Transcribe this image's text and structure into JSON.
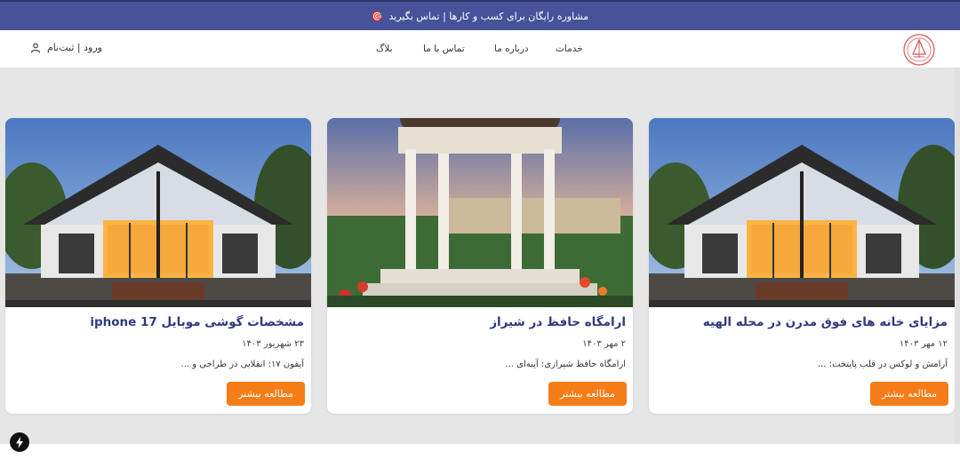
{
  "banner": {
    "text": "مشاوره رایگان برای کسب و کارها | تماس بگیرید",
    "icon": "🎯"
  },
  "nav": {
    "login": "ورود | ثبت‌نام",
    "links": [
      "خدمات",
      "درباره ما",
      "تماس با ما",
      "بلاگ"
    ]
  },
  "cards": [
    {
      "title": "مزایای خانه های فوق مدرن در محله الهیه",
      "date": "۱۲ مهر ۱۴۰۳",
      "excerpt": "آرامش و لوکس در قلب پایتخت: ...",
      "button": "مطالعه بیشتر",
      "image": "modern-house"
    },
    {
      "title": "ارامگاه حافظ در شیراز",
      "date": "۲ مهر ۱۴۰۳",
      "excerpt": "ارامگاه حافظ شیرازی: آینه‌ای ...",
      "button": "مطالعه بیشتر",
      "image": "hafez-tomb"
    },
    {
      "title": "مشخصات گوشی موبایل iphone 17",
      "date": "۲۳ شهریور ۱۴۰۳",
      "excerpt": "آیفون ۱۷: انقلابی در طراحی و ...",
      "button": "مطالعه بیشتر",
      "image": "modern-house"
    }
  ],
  "colors": {
    "banner": "#46539a",
    "title": "#2f3a80",
    "button": "#f57c17",
    "background": "#e6e6e6"
  }
}
